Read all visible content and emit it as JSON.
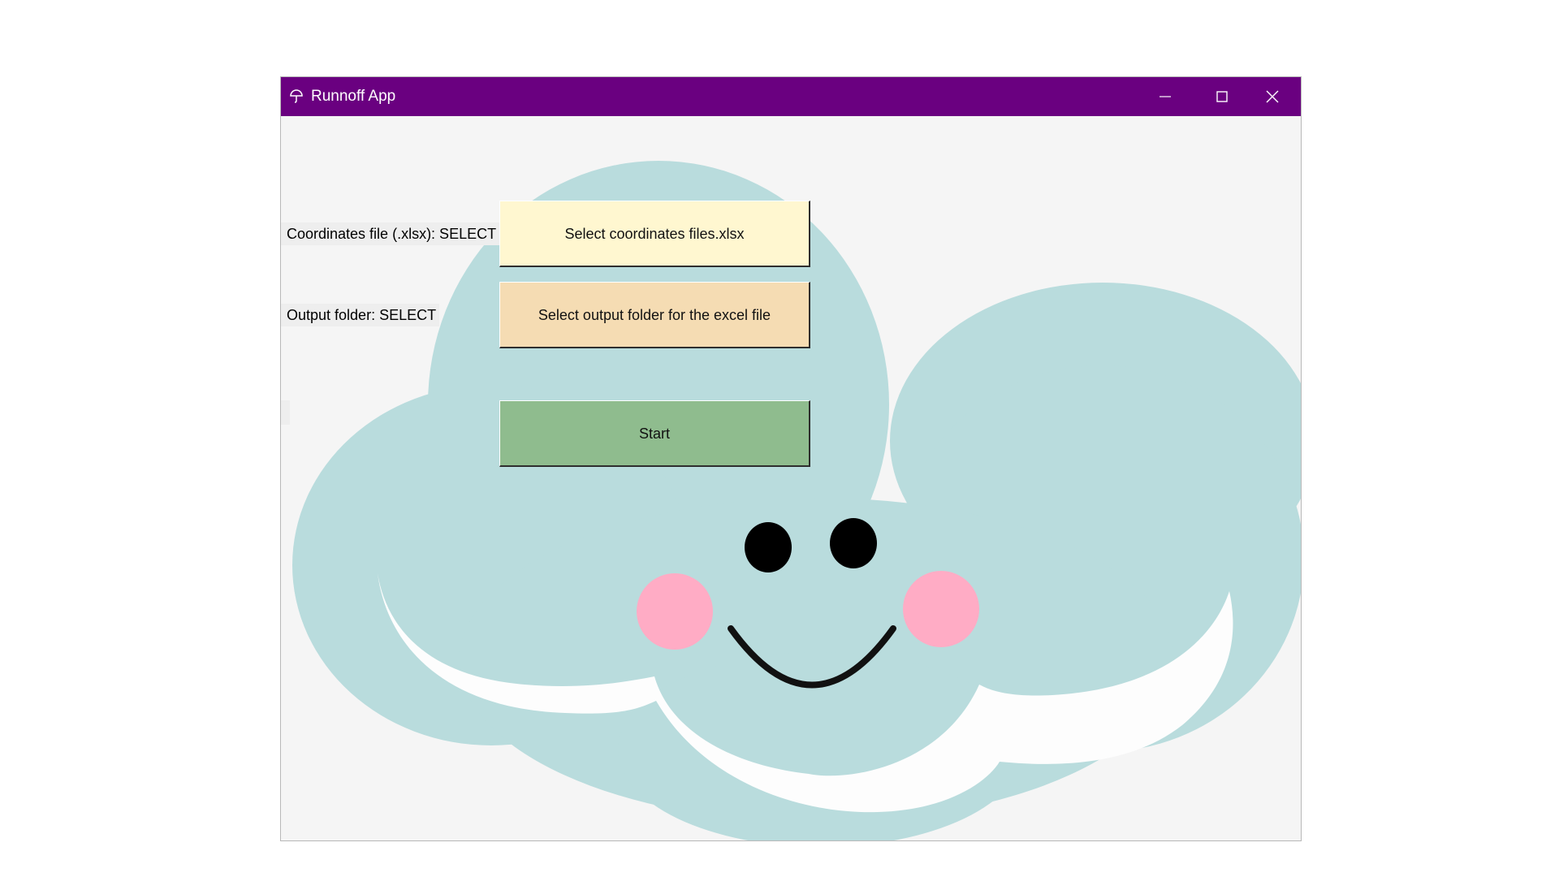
{
  "window": {
    "title": "Runnoff App",
    "titlebar_color": "#6a0080",
    "controls": {
      "minimize_icon": "minimize-icon",
      "maximize_icon": "maximize-icon",
      "close_icon": "close-icon"
    }
  },
  "form": {
    "coordinates_label": "Coordinates file (.xlsx): SELECT",
    "coordinates_button": "Select coordinates files.xlsx",
    "output_label": "Output folder: SELECT",
    "output_button": "Select output folder for the excel file",
    "status_label": "",
    "start_button": "Start"
  },
  "colors": {
    "coordinates_button": "#fff7d0",
    "output_button": "#f5dcb3",
    "start_button": "#8fbc8e",
    "cloud": "#b9dcdd",
    "cheeks": "#ffacc5"
  },
  "background_image": "smiling-cloud"
}
